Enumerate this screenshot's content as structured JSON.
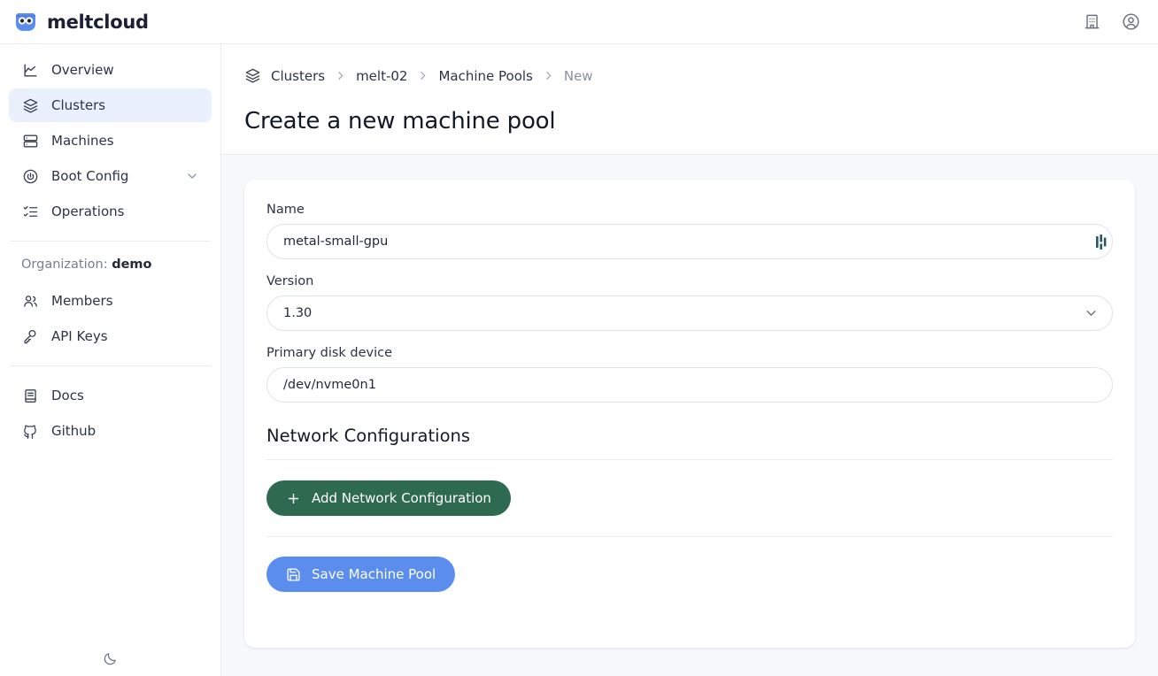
{
  "brand": {
    "name": "meltcloud",
    "logo_icon": "owl-logo-icon",
    "accent": "#5b8def"
  },
  "topbar": {
    "org_icon": "building-icon",
    "account_icon": "user-circle-icon"
  },
  "sidebar": {
    "items": [
      {
        "label": "Overview",
        "icon": "chart-line-icon",
        "active": false
      },
      {
        "label": "Clusters",
        "icon": "layers-icon",
        "active": true
      },
      {
        "label": "Machines",
        "icon": "server-icon",
        "active": false
      },
      {
        "label": "Boot Config",
        "icon": "power-circle-icon",
        "active": false,
        "expandable": true
      },
      {
        "label": "Operations",
        "icon": "checklist-icon",
        "active": false
      }
    ],
    "organization_label": "Organization:",
    "organization_name": "demo",
    "account_items": [
      {
        "label": "Members",
        "icon": "users-icon"
      },
      {
        "label": "API Keys",
        "icon": "key-icon"
      }
    ],
    "external_items": [
      {
        "label": "Docs",
        "icon": "book-icon"
      },
      {
        "label": "Github",
        "icon": "github-icon"
      }
    ],
    "theme_toggle_icon": "moon-icon"
  },
  "breadcrumb": {
    "icon": "layers-icon",
    "items": [
      {
        "label": "Clusters",
        "current": false
      },
      {
        "label": "melt-02",
        "current": false
      },
      {
        "label": "Machine Pools",
        "current": false
      },
      {
        "label": "New",
        "current": true
      }
    ],
    "separator": "chevron-right-icon"
  },
  "page": {
    "title": "Create a new machine pool"
  },
  "form": {
    "name": {
      "label": "Name",
      "value": "metal-small-gpu",
      "placeholder": "Name",
      "extension_icon": "password-manager-icon"
    },
    "version": {
      "label": "Version",
      "value": "1.30",
      "chevron_icon": "chevron-down-icon",
      "options": [
        "1.30"
      ]
    },
    "primary_disk": {
      "label": "Primary disk device",
      "value": "/dev/nvme0n1",
      "placeholder": "/dev/nvme0n1"
    },
    "network_section": {
      "title": "Network Configurations",
      "add_button": {
        "label": "Add Network Configuration",
        "icon": "plus-icon",
        "color": "#2d6a4f"
      }
    },
    "save_button": {
      "label": "Save Machine Pool",
      "icon": "save-disk-icon",
      "color": "#5b8def"
    }
  }
}
